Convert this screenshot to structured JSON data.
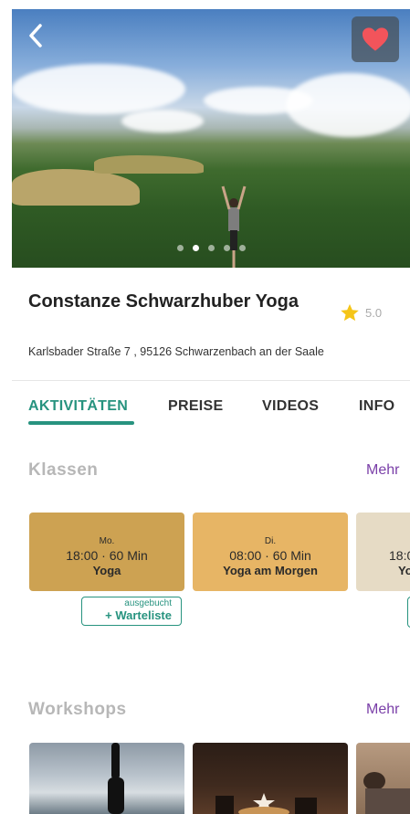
{
  "hero": {
    "back_icon": "chevron-left-icon",
    "favorite_icon": "heart-icon",
    "favorite_color": "#f2545b",
    "carousel_dots": 5,
    "active_dot": 1
  },
  "studio": {
    "name": "Constanze Schwarzhuber Yoga",
    "rating": "5.0",
    "rating_icon": "star-icon",
    "rating_color": "#f5c518",
    "address": "Karlsbader Straße 7 , 95126 Schwarzenbach an der Saale"
  },
  "tabs": [
    {
      "label": "AKTIVITÄTEN",
      "active": true
    },
    {
      "label": "PREISE",
      "active": false
    },
    {
      "label": "VIDEOS",
      "active": false
    },
    {
      "label": "INFO",
      "active": false
    }
  ],
  "accent_color": "#27937f",
  "classes": {
    "title": "Klassen",
    "more": "Mehr",
    "items": [
      {
        "day": "Mo.",
        "time": "18:00 · 60 Min",
        "name": "Yoga",
        "color": "#cda252"
      },
      {
        "day": "Di.",
        "time": "08:00 · 60 Min",
        "name": "Yoga am Morgen",
        "color": "#e7b565"
      },
      {
        "day": "",
        "time": "18:0",
        "name": "Yo",
        "color": "#e6dbc5"
      }
    ],
    "waitlist": {
      "status": "ausgebucht",
      "action": "+ Warteliste"
    }
  },
  "workshops": {
    "title": "Workshops",
    "more": "Mehr"
  }
}
